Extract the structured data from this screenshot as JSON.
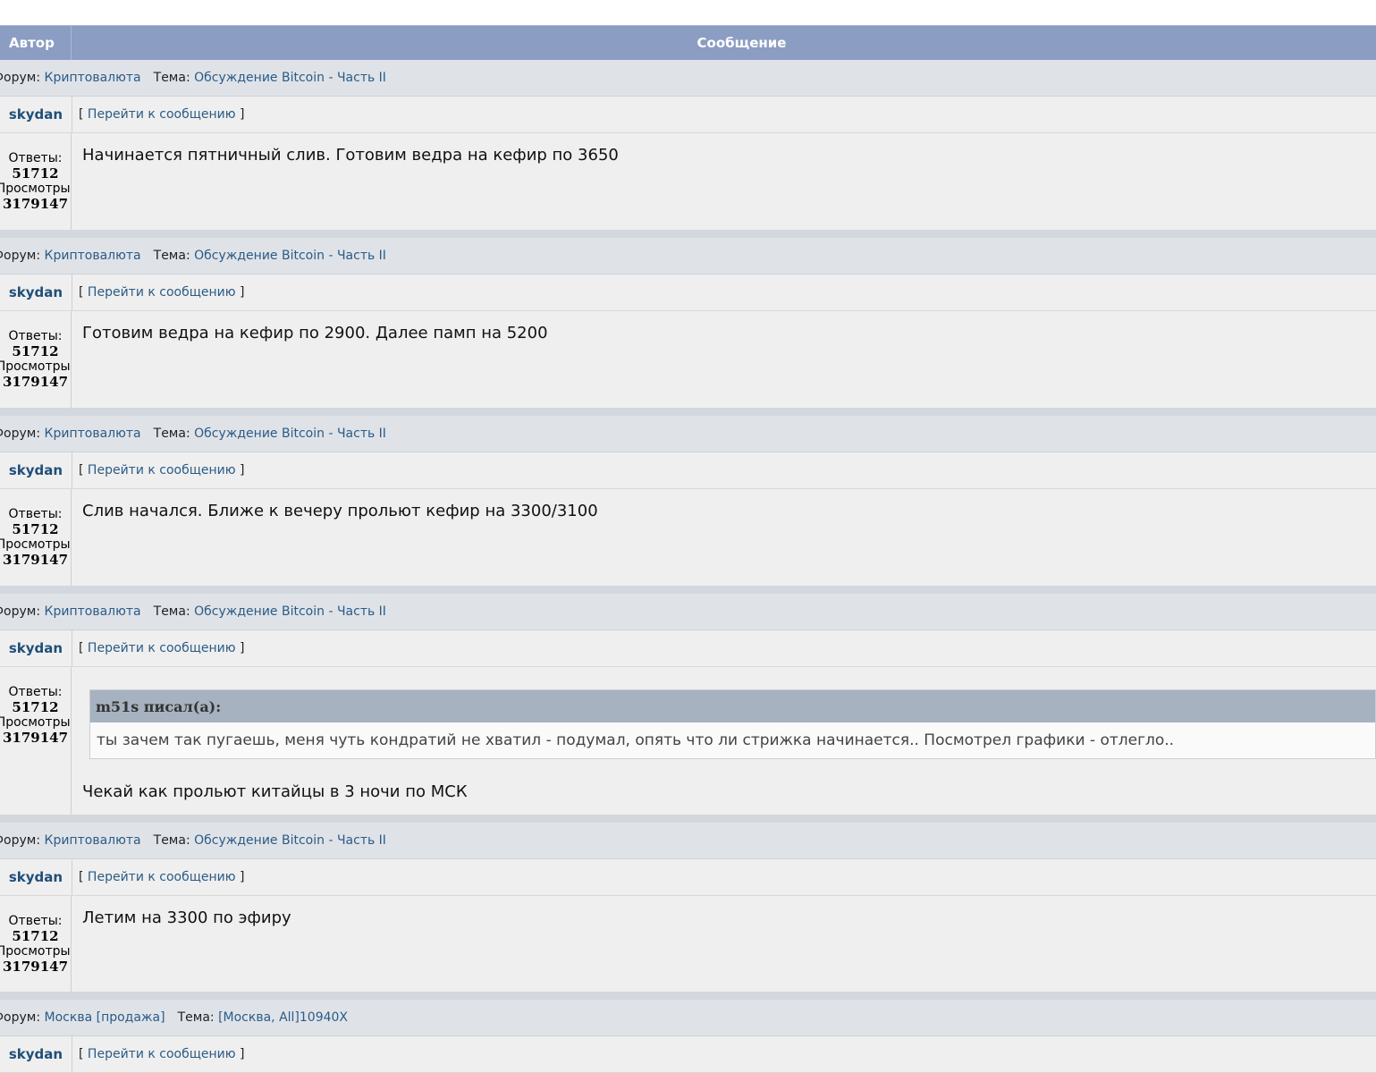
{
  "header": {
    "author_col": "Автор",
    "message_col": "Сообщение"
  },
  "labels": {
    "forum": "Форум:",
    "topic": "Тема:",
    "replies": "Ответы:",
    "views": "Просмотры:",
    "bracket_open": "[",
    "bracket_close": "]",
    "goto_post": "Перейти к сообщению"
  },
  "posts": [
    {
      "forum": "Криптовалюта",
      "topic": "Обсуждение Bitcoin - Часть II",
      "author": "skydan",
      "replies": "51712",
      "views": "3179147",
      "text": "Начинается пятничный слив. Готовим ведра на кефир по 3650"
    },
    {
      "forum": "Криптовалюта",
      "topic": "Обсуждение Bitcoin - Часть II",
      "author": "skydan",
      "replies": "51712",
      "views": "3179147",
      "text": "Готовим ведра на кефир по 2900. Далее памп на 5200"
    },
    {
      "forum": "Криптовалюта",
      "topic": "Обсуждение Bitcoin - Часть II",
      "author": "skydan",
      "replies": "51712",
      "views": "3179147",
      "text": "Слив начался. Ближе к вечеру прольют кефир на 3300/3100"
    },
    {
      "forum": "Криптовалюта",
      "topic": "Обсуждение Bitcoin - Часть II",
      "author": "skydan",
      "replies": "51712",
      "views": "3179147",
      "quote_author": "m51s писал(а):",
      "quote_text": "ты зачем так пугаешь, меня чуть кондратий не хватил - подумал, опять что ли стрижка начинается.. Посмотрел графики - отлегло..",
      "text": "Чекай как прольют китайцы в 3 ночи по МСК"
    },
    {
      "forum": "Криптовалюта",
      "topic": "Обсуждение Bitcoin - Часть II",
      "author": "skydan",
      "replies": "51712",
      "views": "3179147",
      "text": "Летим на 3300 по эфиру"
    },
    {
      "forum": "Москва [продажа]",
      "topic": "[Москва, All]10940X",
      "author": "skydan"
    }
  ]
}
